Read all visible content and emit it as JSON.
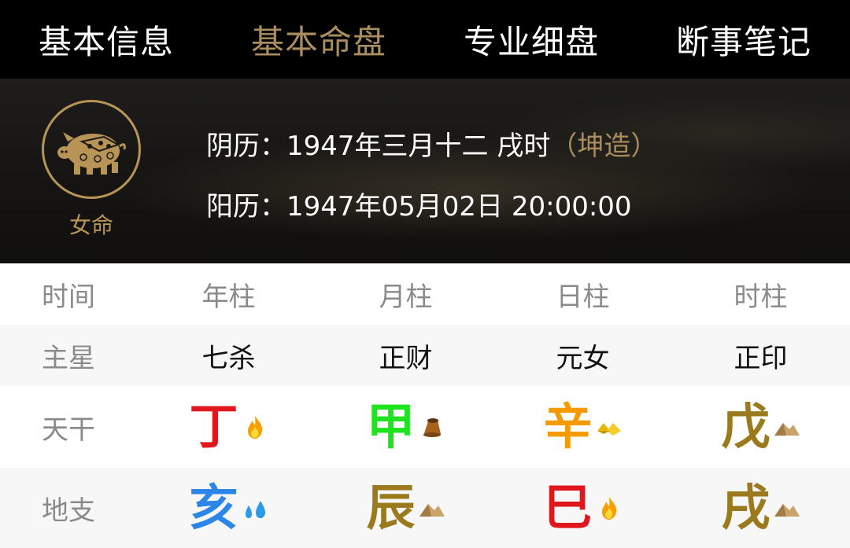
{
  "tabs": [
    {
      "label": "基本信息",
      "active": false
    },
    {
      "label": "基本命盘",
      "active": true
    },
    {
      "label": "专业细盘",
      "active": false
    },
    {
      "label": "断事笔记",
      "active": false
    }
  ],
  "profile": {
    "emblem_icon": "pig-zodiac-icon",
    "gender_label": "女命",
    "lunar_prefix": "阴历：",
    "lunar_date": "1947年三月十二  戌时",
    "lunar_tag": "（坤造）",
    "solar_prefix": "阳历：",
    "solar_date": "1947年05月02日 20:00:00"
  },
  "chart": {
    "header": [
      "时间",
      "年柱",
      "月柱",
      "日柱",
      "时柱"
    ],
    "main_star": {
      "label": "主星",
      "values": [
        "七杀",
        "正财",
        "元女",
        "正印"
      ]
    },
    "heavenly_stem": {
      "label": "天干",
      "values": [
        {
          "char": "丁",
          "color": "#e1171e",
          "icon": "fire-icon"
        },
        {
          "char": "甲",
          "color": "#1fe31f",
          "icon": "wood-icon"
        },
        {
          "char": "辛",
          "color": "#f59a00",
          "icon": "metal-icon"
        },
        {
          "char": "戊",
          "color": "#9a7a1c",
          "icon": "earth-icon"
        }
      ]
    },
    "earthly_branch": {
      "label": "地支",
      "values": [
        {
          "char": "亥",
          "color": "#2b86e8",
          "icon": "water-icon"
        },
        {
          "char": "辰",
          "color": "#9a7a1c",
          "icon": "earth-icon"
        },
        {
          "char": "巳",
          "color": "#e1171e",
          "icon": "fire-icon"
        },
        {
          "char": "戌",
          "color": "#9a7a1c",
          "icon": "earth-icon"
        }
      ]
    }
  },
  "colors": {
    "accent_gold": "#a98d5e",
    "emblem_gold": "#b89456"
  }
}
